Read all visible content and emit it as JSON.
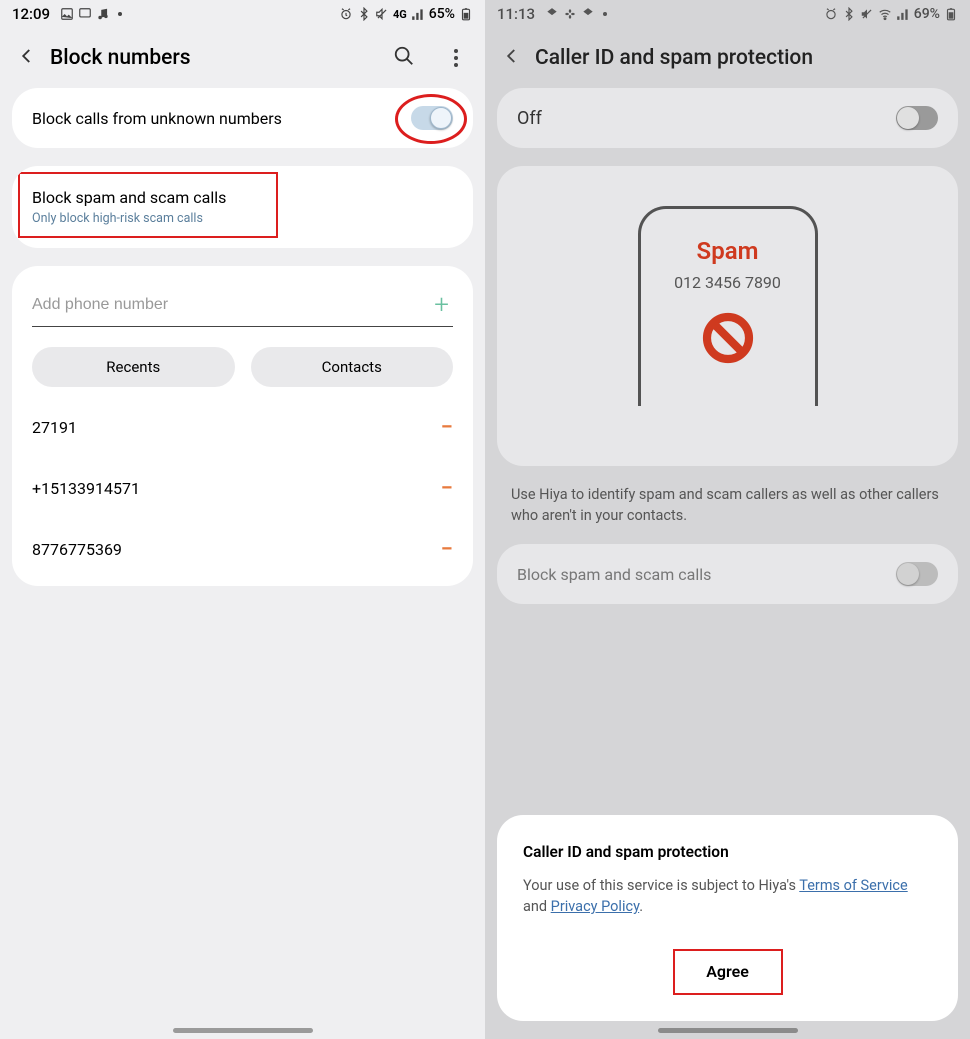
{
  "left": {
    "status": {
      "time": "12:09",
      "battery": "65%",
      "network": "4G"
    },
    "header": {
      "title": "Block numbers"
    },
    "card1": {
      "title": "Block calls from unknown numbers"
    },
    "card2": {
      "title": "Block spam and scam calls",
      "subtitle": "Only block high-risk scam calls"
    },
    "input": {
      "placeholder": "Add phone number"
    },
    "chips": {
      "recents": "Recents",
      "contacts": "Contacts"
    },
    "numbers": [
      "27191",
      "+15133914571",
      "8776775369"
    ]
  },
  "right": {
    "status": {
      "time": "11:13",
      "battery": "69%"
    },
    "header": {
      "title": "Caller ID and spam protection"
    },
    "off_row": {
      "label": "Off"
    },
    "spam": {
      "label": "Spam",
      "number": "012 3456 7890"
    },
    "desc": "Use Hiya to identify spam and scam callers as well as other callers who aren't in your contacts.",
    "block_row": {
      "label": "Block spam and scam calls"
    },
    "sheet": {
      "title": "Caller ID and spam protection",
      "prefix": "Your use of this service is subject to Hiya's ",
      "tos": "Terms of Service",
      "and": " and ",
      "pp": "Privacy Policy",
      "period": ".",
      "agree": "Agree"
    }
  }
}
